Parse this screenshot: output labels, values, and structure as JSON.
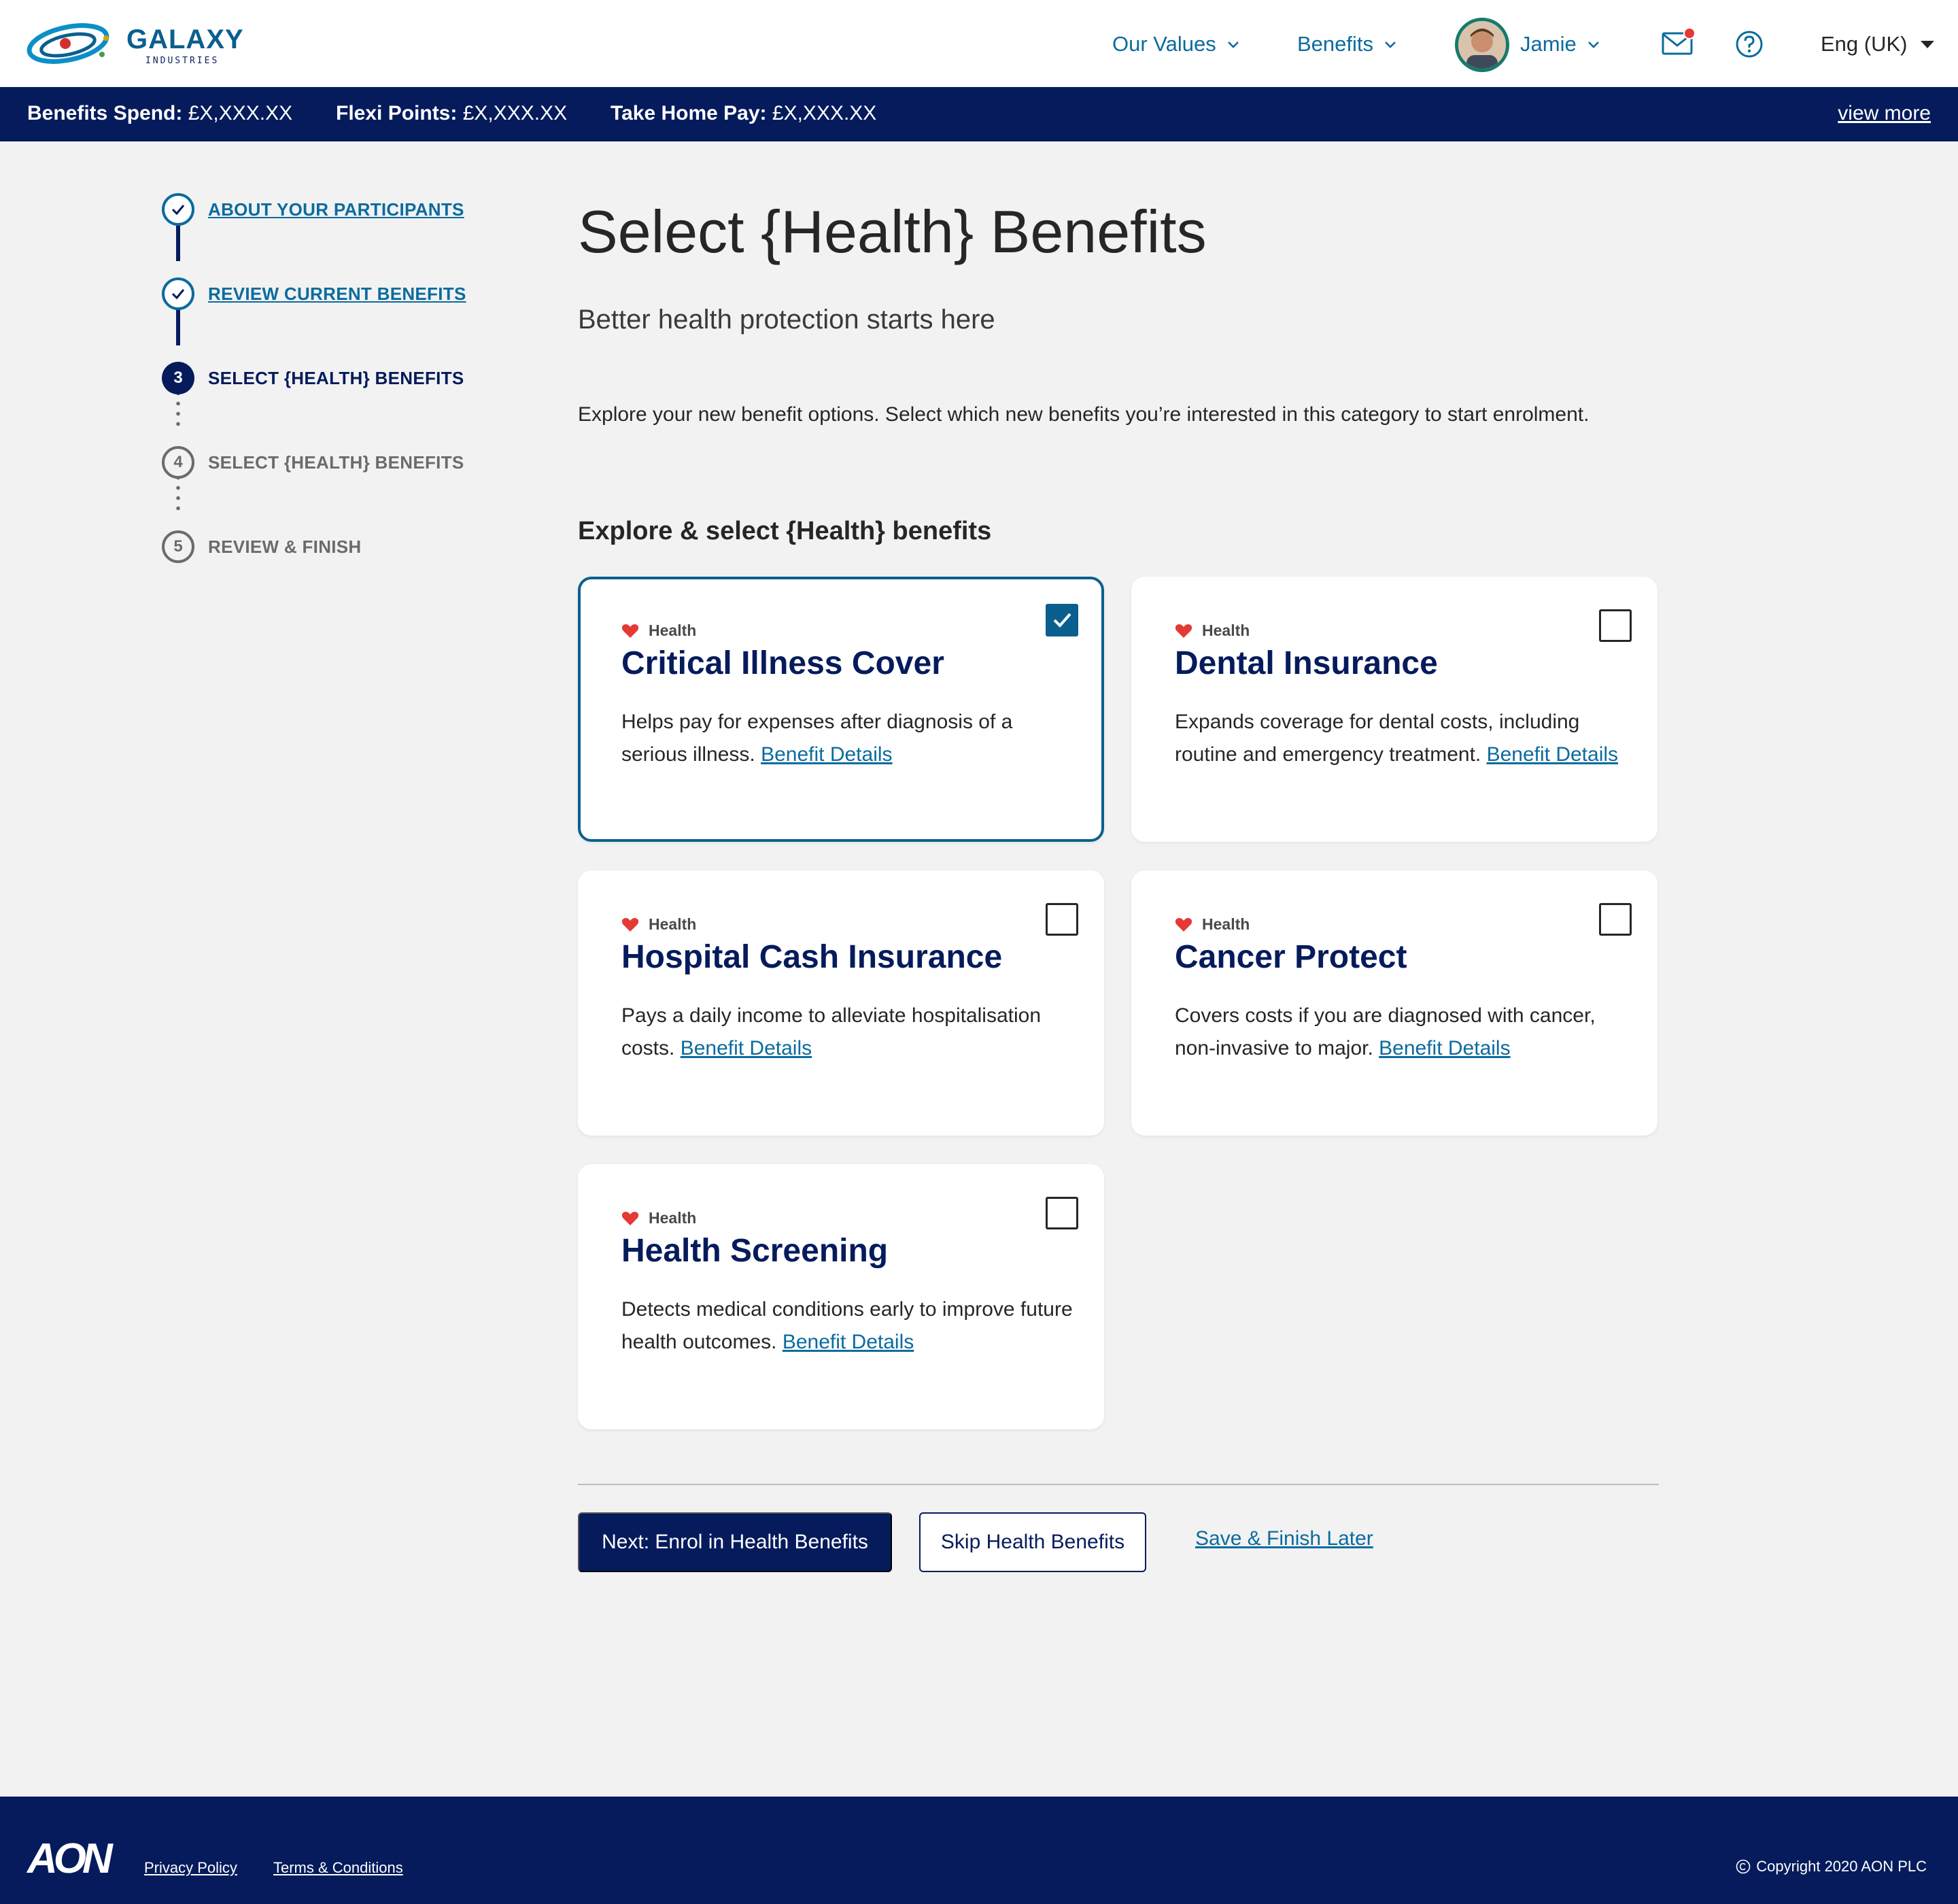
{
  "header": {
    "brand_name": "GALAXY",
    "brand_sub": "INDUSTRIES",
    "nav": {
      "our_values": "Our Values",
      "benefits": "Benefits",
      "user_name": "Jamie"
    },
    "language": "Eng (UK)"
  },
  "summary_bar": {
    "benefits_spend_label": "Benefits Spend:",
    "benefits_spend_value": "£X,XXX.XX",
    "flexi_points_label": "Flexi Points:",
    "flexi_points_value": "£X,XXX.XX",
    "take_home_label": "Take Home Pay:",
    "take_home_value": "£X,XXX.XX",
    "view_more": "view more"
  },
  "stepper": {
    "steps": [
      {
        "number": "1",
        "label": "ABOUT YOUR PARTICIPANTS",
        "state": "done"
      },
      {
        "number": "2",
        "label": "REVIEW CURRENT BENEFITS",
        "state": "done"
      },
      {
        "number": "3",
        "label": "SELECT {HEALTH} BENEFITS",
        "state": "current"
      },
      {
        "number": "4",
        "label": "SELECT {HEALTH} BENEFITS",
        "state": "todo"
      },
      {
        "number": "5",
        "label": "REVIEW & FINISH",
        "state": "todo"
      }
    ]
  },
  "main": {
    "title": "Select {Health} Benefits",
    "subtitle": "Better health protection starts here",
    "intro": "Explore your new benefit options. Select which new benefits you’re interested in this category to start enrolment.",
    "section_heading": "Explore & select {Health} benefits",
    "cards": [
      {
        "tag": "Health",
        "title": "Critical Illness Cover",
        "description": "Helps pay for expenses after diagnosis of a serious illness.",
        "link": "Benefit Details",
        "selected": true
      },
      {
        "tag": "Health",
        "title": "Dental Insurance",
        "description": "Expands coverage for dental costs, including routine and emergency treatment.",
        "link": "Benefit Details",
        "selected": false
      },
      {
        "tag": "Health",
        "title": "Hospital Cash Insurance",
        "description": "Pays a daily income to alleviate hospitalisation costs.",
        "link": "Benefit Details",
        "selected": false
      },
      {
        "tag": "Health",
        "title": "Cancer Protect",
        "description": "Covers costs if you are diagnosed with cancer, non-invasive to major.",
        "link": "Benefit Details",
        "selected": false
      },
      {
        "tag": "Health",
        "title": "Health Screening",
        "description": "Detects medical conditions early to improve future health outcomes.",
        "link": "Benefit Details",
        "selected": false
      }
    ],
    "actions": {
      "next": "Next: Enrol in Health Benefits",
      "skip": "Skip Health Benefits",
      "save": "Save & Finish Later"
    }
  },
  "footer": {
    "logo": "AON",
    "privacy": "Privacy Policy",
    "terms": "Terms & Conditions",
    "copyright": "Copyright 2020 AON PLC"
  },
  "colors": {
    "navy": "#051b5c",
    "link_blue": "#0b6b9e",
    "heart_red": "#e53935",
    "background": "#f2f2f2"
  },
  "icons": [
    "galaxy-logo-icon",
    "chevron-down-icon",
    "avatar",
    "mail-icon",
    "help-icon",
    "caret-down-icon",
    "check-icon",
    "heart-icon",
    "copyright-icon"
  ]
}
